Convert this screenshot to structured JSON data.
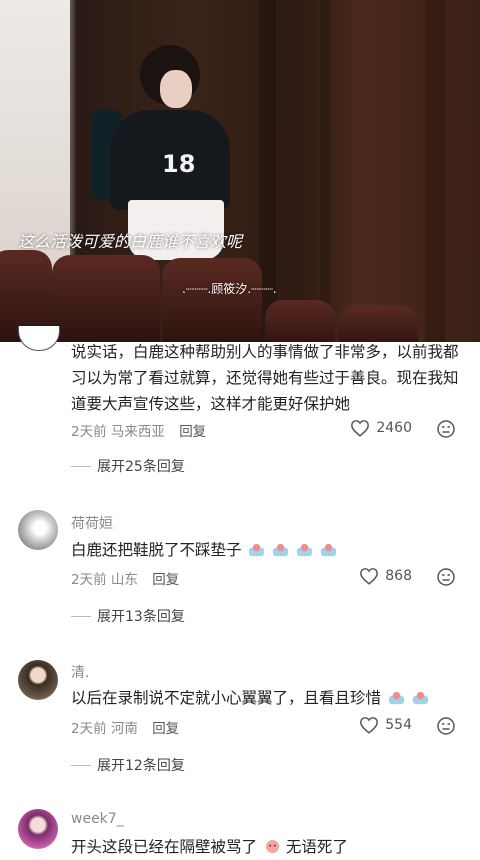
{
  "video": {
    "caption": "这么活泼可爱的白鹿谁不喜欢呢",
    "credit": ".┈┈┈.顾筱汐.┈┈┈.",
    "shirt_text": "18"
  },
  "comments": [
    {
      "text": "说实话，白鹿这种帮助别人的事情做了非常多，以前我都习以为常了看过就算，还觉得她有些过于善良。现在我知道要大声宣传这些，这样才能更好保护她",
      "time": "2天前",
      "location": "马来西亚",
      "reply": "回复",
      "likes": "2460",
      "expand": "展开25条回复"
    },
    {
      "user": "荷荷姮",
      "text": "白鹿还把鞋脱了不踩垫子",
      "time": "2天前",
      "location": "山东",
      "reply": "回复",
      "likes": "868",
      "expand": "展开13条回复"
    },
    {
      "user": "清.",
      "text": "以后在录制说不定就小心翼翼了，且看且珍惜",
      "time": "2天前",
      "location": "河南",
      "reply": "回复",
      "likes": "554",
      "expand": "展开12条回复"
    },
    {
      "user": "week7_",
      "text_a": "开头这段已经在隔壁被骂了",
      "text_b": "无语死了"
    }
  ]
}
